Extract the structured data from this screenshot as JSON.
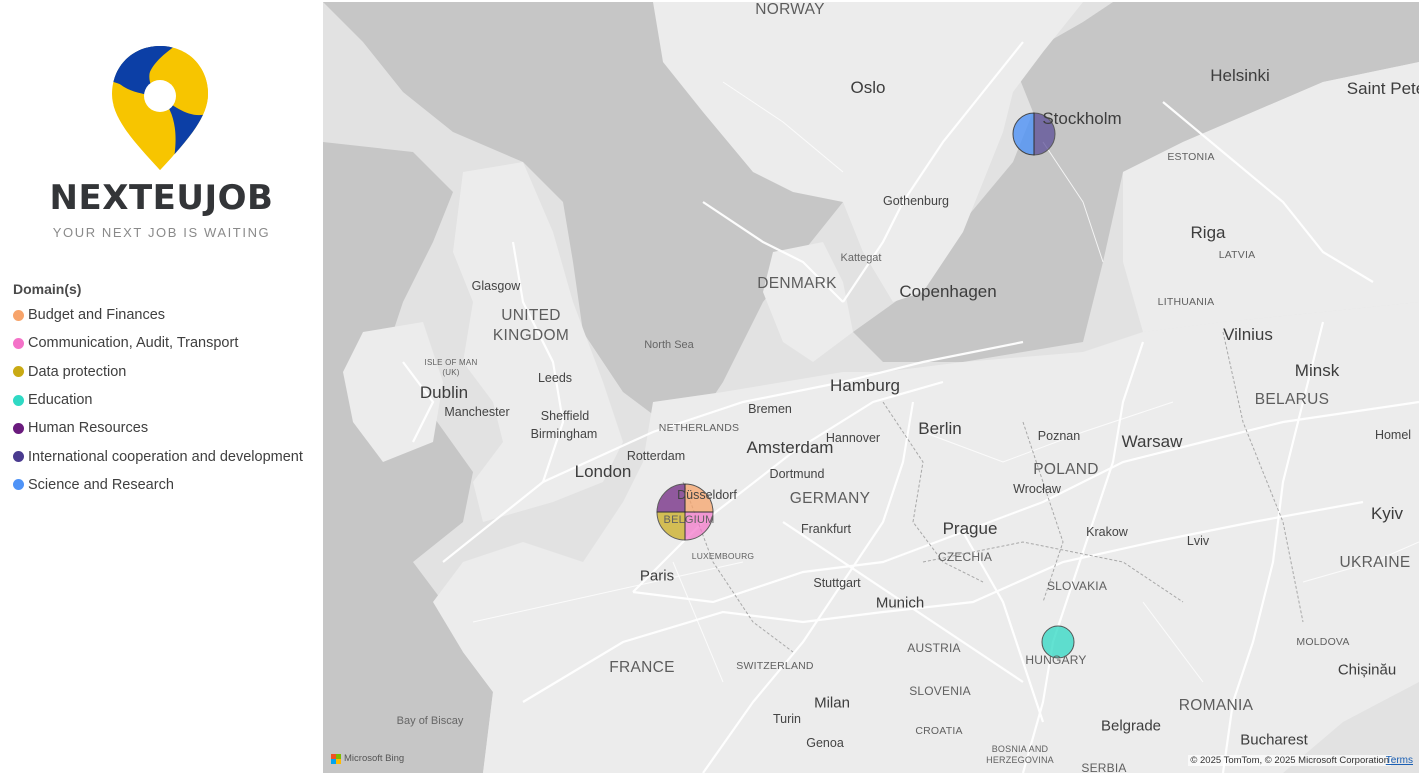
{
  "brand": {
    "name": "NEXTEUJOB",
    "tagline": "YOUR NEXT JOB IS WAITING",
    "colors": {
      "blue": "#0c3fa6",
      "yellow": "#f7c500",
      "text": "#333538"
    }
  },
  "legend": {
    "title": "Domain(s)",
    "items": [
      {
        "label": "Budget and Finances",
        "color": "#f7a46b"
      },
      {
        "label": "Communication, Audit, Transport",
        "color": "#f472c8"
      },
      {
        "label": "Data protection",
        "color": "#c9aa14"
      },
      {
        "label": "Education",
        "color": "#2fd9c4"
      },
      {
        "label": "Human Resources",
        "color": "#6a1b7d"
      },
      {
        "label": "International cooperation and development",
        "color": "#4a3b8f"
      },
      {
        "label": "Science and Research",
        "color": "#4f93f7"
      }
    ]
  },
  "map": {
    "labels": {
      "norway": "NORWAY",
      "oslo": "Oslo",
      "helsinki": "Helsinki",
      "saint_pete": "Saint Pete",
      "stockholm": "Stockholm",
      "estonia": "ESTONIA",
      "gothenburg": "Gothenburg",
      "riga": "Riga",
      "latvia": "LATVIA",
      "kattegat": "Kattegat",
      "denmark": "DENMARK",
      "copenhagen": "Copenhagen",
      "lithuania": "LITHUANIA",
      "vilnius": "Vilnius",
      "glasgow": "Glasgow",
      "united_kingdom": "UNITED\nKINGDOM",
      "north_sea": "North Sea",
      "isle_of_man": "ISLE OF MAN\n(UK)",
      "dublin": "Dublin",
      "leeds": "Leeds",
      "manchester": "Manchester",
      "sheffield": "Sheffield",
      "birmingham": "Birmingham",
      "hamburg": "Hamburg",
      "bremen": "Bremen",
      "netherlands": "NETHERLANDS",
      "amsterdam": "Amsterdam",
      "hannover": "Hannover",
      "berlin": "Berlin",
      "poznan": "Poznan",
      "warsaw": "Warsaw",
      "minsk": "Minsk",
      "belarus": "BELARUS",
      "homel": "Homel",
      "london": "London",
      "rotterdam": "Rotterdam",
      "dortmund": "Dortmund",
      "germany": "GERMANY",
      "poland": "POLAND",
      "wroclaw": "Wrocław",
      "dusseldorf": "Düsseldorf",
      "belgium": "BELGIUM",
      "frankfurt": "Frankfurt",
      "prague": "Prague",
      "krakow": "Krakow",
      "czechia": "CZECHIA",
      "lviv": "Lviv",
      "kyiv": "Kyiv",
      "luxembourg": "LUXEMBOURG",
      "paris": "Paris",
      "stuttgart": "Stuttgart",
      "slovakia": "SLOVAKIA",
      "ukraine": "UKRAINE",
      "munich": "Munich",
      "austria": "AUSTRIA",
      "moldova": "MOLDOVA",
      "france": "FRANCE",
      "switzerland": "SWITZERLAND",
      "hungary": "HUNGARY",
      "chisinau": "Chișinău",
      "slovenia": "SLOVENIA",
      "milan": "Milan",
      "turin": "Turin",
      "romania": "ROMANIA",
      "bay_of_biscay": "Bay of Biscay",
      "croatia": "CROATIA",
      "belgrade": "Belgrade",
      "genoa": "Genoa",
      "bosnia": "BOSNIA AND\nHERZEGOVINA",
      "bucharest": "Bucharest",
      "serbia": "SERBIA"
    },
    "pies": [
      {
        "location": "Stockholm",
        "domains": [
          "Science and Research",
          "International cooperation and development"
        ]
      },
      {
        "location": "Belgium",
        "domains": [
          "Budget and Finances",
          "Communication, Audit, Transport",
          "Data protection",
          "Human Resources"
        ]
      },
      {
        "location": "Hungary",
        "domains": [
          "Education"
        ]
      }
    ],
    "attribution": "© 2025 TomTom, © 2025 Microsoft Corporation",
    "terms": "Terms",
    "provider": "Microsoft Bing"
  }
}
